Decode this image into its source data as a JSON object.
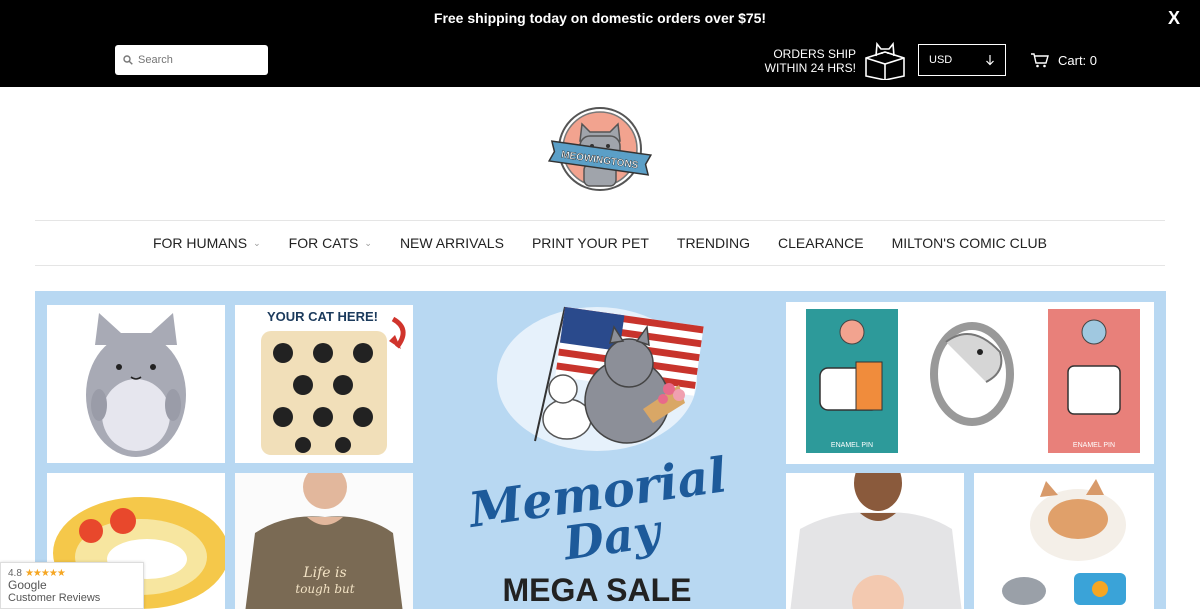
{
  "topbar": {
    "announcement": "Free shipping today on domestic orders over $75!",
    "close_label": "X",
    "search_placeholder": "Search",
    "ship_line1": "ORDERS SHIP",
    "ship_line2": "WITHIN 24 HRS!",
    "currency": "USD",
    "cart_label": "Cart: 0"
  },
  "logo": {
    "text": "MEOWINGTONS"
  },
  "nav": {
    "items": [
      {
        "label": "FOR HUMANS",
        "has_dropdown": true
      },
      {
        "label": "FOR CATS",
        "has_dropdown": true
      },
      {
        "label": "NEW ARRIVALS"
      },
      {
        "label": "PRINT YOUR PET"
      },
      {
        "label": "TRENDING"
      },
      {
        "label": "CLEARANCE"
      },
      {
        "label": "MILTON'S COMIC CLUB"
      }
    ]
  },
  "hero": {
    "pillow_caption": "YOUR CAT HERE!",
    "headline_script_1": "Memorial",
    "headline_script_2": "Day",
    "headline_sale": "MEGA SALE",
    "pin_label_1": "ENAMEL PIN",
    "pin_label_2": "ENAMEL PIN",
    "shirt_text_1": "Life is",
    "shirt_text_2": "tough but"
  },
  "badge": {
    "rating": "4.8",
    "stars": "★★★★★",
    "source": "Google",
    "subtitle": "Customer Reviews"
  },
  "colors": {
    "topbar_bg": "#000000",
    "hero_bg": "#b8d8f2",
    "headline_blue": "#1d5a9a",
    "star_orange": "#f5a623"
  }
}
